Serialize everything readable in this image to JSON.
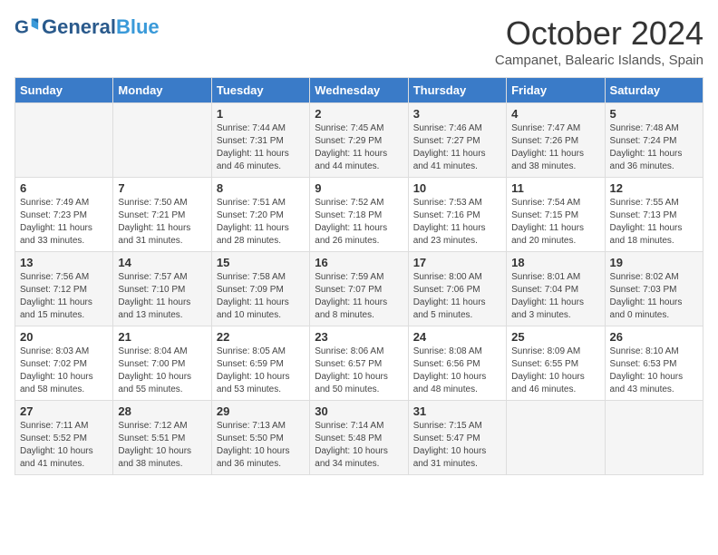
{
  "header": {
    "logo_general": "General",
    "logo_blue": "Blue",
    "title": "October 2024",
    "location": "Campanet, Balearic Islands, Spain"
  },
  "days_of_week": [
    "Sunday",
    "Monday",
    "Tuesday",
    "Wednesday",
    "Thursday",
    "Friday",
    "Saturday"
  ],
  "weeks": [
    [
      {
        "day": "",
        "content": ""
      },
      {
        "day": "",
        "content": ""
      },
      {
        "day": "1",
        "content": "Sunrise: 7:44 AM\nSunset: 7:31 PM\nDaylight: 11 hours and 46 minutes."
      },
      {
        "day": "2",
        "content": "Sunrise: 7:45 AM\nSunset: 7:29 PM\nDaylight: 11 hours and 44 minutes."
      },
      {
        "day": "3",
        "content": "Sunrise: 7:46 AM\nSunset: 7:27 PM\nDaylight: 11 hours and 41 minutes."
      },
      {
        "day": "4",
        "content": "Sunrise: 7:47 AM\nSunset: 7:26 PM\nDaylight: 11 hours and 38 minutes."
      },
      {
        "day": "5",
        "content": "Sunrise: 7:48 AM\nSunset: 7:24 PM\nDaylight: 11 hours and 36 minutes."
      }
    ],
    [
      {
        "day": "6",
        "content": "Sunrise: 7:49 AM\nSunset: 7:23 PM\nDaylight: 11 hours and 33 minutes."
      },
      {
        "day": "7",
        "content": "Sunrise: 7:50 AM\nSunset: 7:21 PM\nDaylight: 11 hours and 31 minutes."
      },
      {
        "day": "8",
        "content": "Sunrise: 7:51 AM\nSunset: 7:20 PM\nDaylight: 11 hours and 28 minutes."
      },
      {
        "day": "9",
        "content": "Sunrise: 7:52 AM\nSunset: 7:18 PM\nDaylight: 11 hours and 26 minutes."
      },
      {
        "day": "10",
        "content": "Sunrise: 7:53 AM\nSunset: 7:16 PM\nDaylight: 11 hours and 23 minutes."
      },
      {
        "day": "11",
        "content": "Sunrise: 7:54 AM\nSunset: 7:15 PM\nDaylight: 11 hours and 20 minutes."
      },
      {
        "day": "12",
        "content": "Sunrise: 7:55 AM\nSunset: 7:13 PM\nDaylight: 11 hours and 18 minutes."
      }
    ],
    [
      {
        "day": "13",
        "content": "Sunrise: 7:56 AM\nSunset: 7:12 PM\nDaylight: 11 hours and 15 minutes."
      },
      {
        "day": "14",
        "content": "Sunrise: 7:57 AM\nSunset: 7:10 PM\nDaylight: 11 hours and 13 minutes."
      },
      {
        "day": "15",
        "content": "Sunrise: 7:58 AM\nSunset: 7:09 PM\nDaylight: 11 hours and 10 minutes."
      },
      {
        "day": "16",
        "content": "Sunrise: 7:59 AM\nSunset: 7:07 PM\nDaylight: 11 hours and 8 minutes."
      },
      {
        "day": "17",
        "content": "Sunrise: 8:00 AM\nSunset: 7:06 PM\nDaylight: 11 hours and 5 minutes."
      },
      {
        "day": "18",
        "content": "Sunrise: 8:01 AM\nSunset: 7:04 PM\nDaylight: 11 hours and 3 minutes."
      },
      {
        "day": "19",
        "content": "Sunrise: 8:02 AM\nSunset: 7:03 PM\nDaylight: 11 hours and 0 minutes."
      }
    ],
    [
      {
        "day": "20",
        "content": "Sunrise: 8:03 AM\nSunset: 7:02 PM\nDaylight: 10 hours and 58 minutes."
      },
      {
        "day": "21",
        "content": "Sunrise: 8:04 AM\nSunset: 7:00 PM\nDaylight: 10 hours and 55 minutes."
      },
      {
        "day": "22",
        "content": "Sunrise: 8:05 AM\nSunset: 6:59 PM\nDaylight: 10 hours and 53 minutes."
      },
      {
        "day": "23",
        "content": "Sunrise: 8:06 AM\nSunset: 6:57 PM\nDaylight: 10 hours and 50 minutes."
      },
      {
        "day": "24",
        "content": "Sunrise: 8:08 AM\nSunset: 6:56 PM\nDaylight: 10 hours and 48 minutes."
      },
      {
        "day": "25",
        "content": "Sunrise: 8:09 AM\nSunset: 6:55 PM\nDaylight: 10 hours and 46 minutes."
      },
      {
        "day": "26",
        "content": "Sunrise: 8:10 AM\nSunset: 6:53 PM\nDaylight: 10 hours and 43 minutes."
      }
    ],
    [
      {
        "day": "27",
        "content": "Sunrise: 7:11 AM\nSunset: 5:52 PM\nDaylight: 10 hours and 41 minutes."
      },
      {
        "day": "28",
        "content": "Sunrise: 7:12 AM\nSunset: 5:51 PM\nDaylight: 10 hours and 38 minutes."
      },
      {
        "day": "29",
        "content": "Sunrise: 7:13 AM\nSunset: 5:50 PM\nDaylight: 10 hours and 36 minutes."
      },
      {
        "day": "30",
        "content": "Sunrise: 7:14 AM\nSunset: 5:48 PM\nDaylight: 10 hours and 34 minutes."
      },
      {
        "day": "31",
        "content": "Sunrise: 7:15 AM\nSunset: 5:47 PM\nDaylight: 10 hours and 31 minutes."
      },
      {
        "day": "",
        "content": ""
      },
      {
        "day": "",
        "content": ""
      }
    ]
  ]
}
